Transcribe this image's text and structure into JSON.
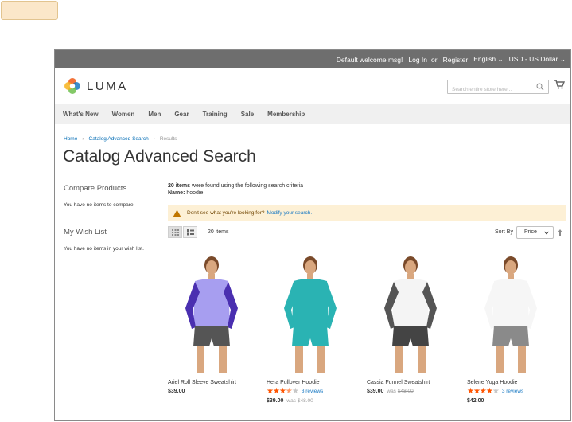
{
  "header": {
    "welcome": "Default welcome msg!",
    "login": "Log In",
    "or": "or",
    "register": "Register",
    "language": "English",
    "currency": "USD - US Dollar"
  },
  "brand": {
    "name": "LUMA",
    "search_placeholder": "Search entire store here..."
  },
  "nav": [
    "What's New",
    "Women",
    "Men",
    "Gear",
    "Training",
    "Sale",
    "Membership"
  ],
  "breadcrumbs": [
    "Home",
    "Catalog Advanced Search",
    "Results"
  ],
  "page_title": "Catalog Advanced Search",
  "sidebar": {
    "compare_title": "Compare Products",
    "compare_empty": "You have no items to compare.",
    "wishlist_title": "My Wish List",
    "wishlist_empty": "You have no items in your wish list."
  },
  "results": {
    "count_bold": "20 items",
    "count_text": "were found using the following search criteria",
    "name_label": "Name:",
    "name_value": "hoodie",
    "notice_text": "Don't see what you're looking for?",
    "notice_link": "Modify your search.",
    "amount": "20 items",
    "sort_label": "Sort By",
    "sort_value": "Price"
  },
  "products": [
    {
      "name": "Ariel Roll Sleeve Sweatshirt",
      "price": "$39.00",
      "rating": 0,
      "reviews": "",
      "was_label": "",
      "old_price": "",
      "colors": {
        "shirt": "#a79ef0",
        "sleeve": "#4a2fb0",
        "shorts": "#555555"
      }
    },
    {
      "name": "Hera Pullover Hoodie",
      "price": "$39.00",
      "rating": 3.5,
      "reviews": "3 reviews",
      "was_label": "was",
      "old_price": "$48.00",
      "colors": {
        "shirt": "#2ab3b3",
        "sleeve": "#2ab3b3",
        "shorts": "#2ab3b3"
      }
    },
    {
      "name": "Cassia Funnel Sweatshirt",
      "price": "$39.00",
      "rating": 0,
      "reviews": "",
      "was_label": "was",
      "old_price": "$48.00",
      "colors": {
        "shirt": "#f4f4f4",
        "sleeve": "#555555",
        "shorts": "#444444"
      }
    },
    {
      "name": "Selene Yoga Hoodie",
      "price": "$42.00",
      "rating": 4,
      "reviews": "3 reviews",
      "was_label": "",
      "old_price": "",
      "colors": {
        "shirt": "#f6f6f6",
        "sleeve": "#f6f6f6",
        "shorts": "#8a8a8a"
      }
    }
  ],
  "colors": {
    "header_bg": "#6e6e6e",
    "nav_bg": "#f0f0f0",
    "link": "#1979c3",
    "notice_bg": "#fdf0d5",
    "star": "#ff5501"
  }
}
